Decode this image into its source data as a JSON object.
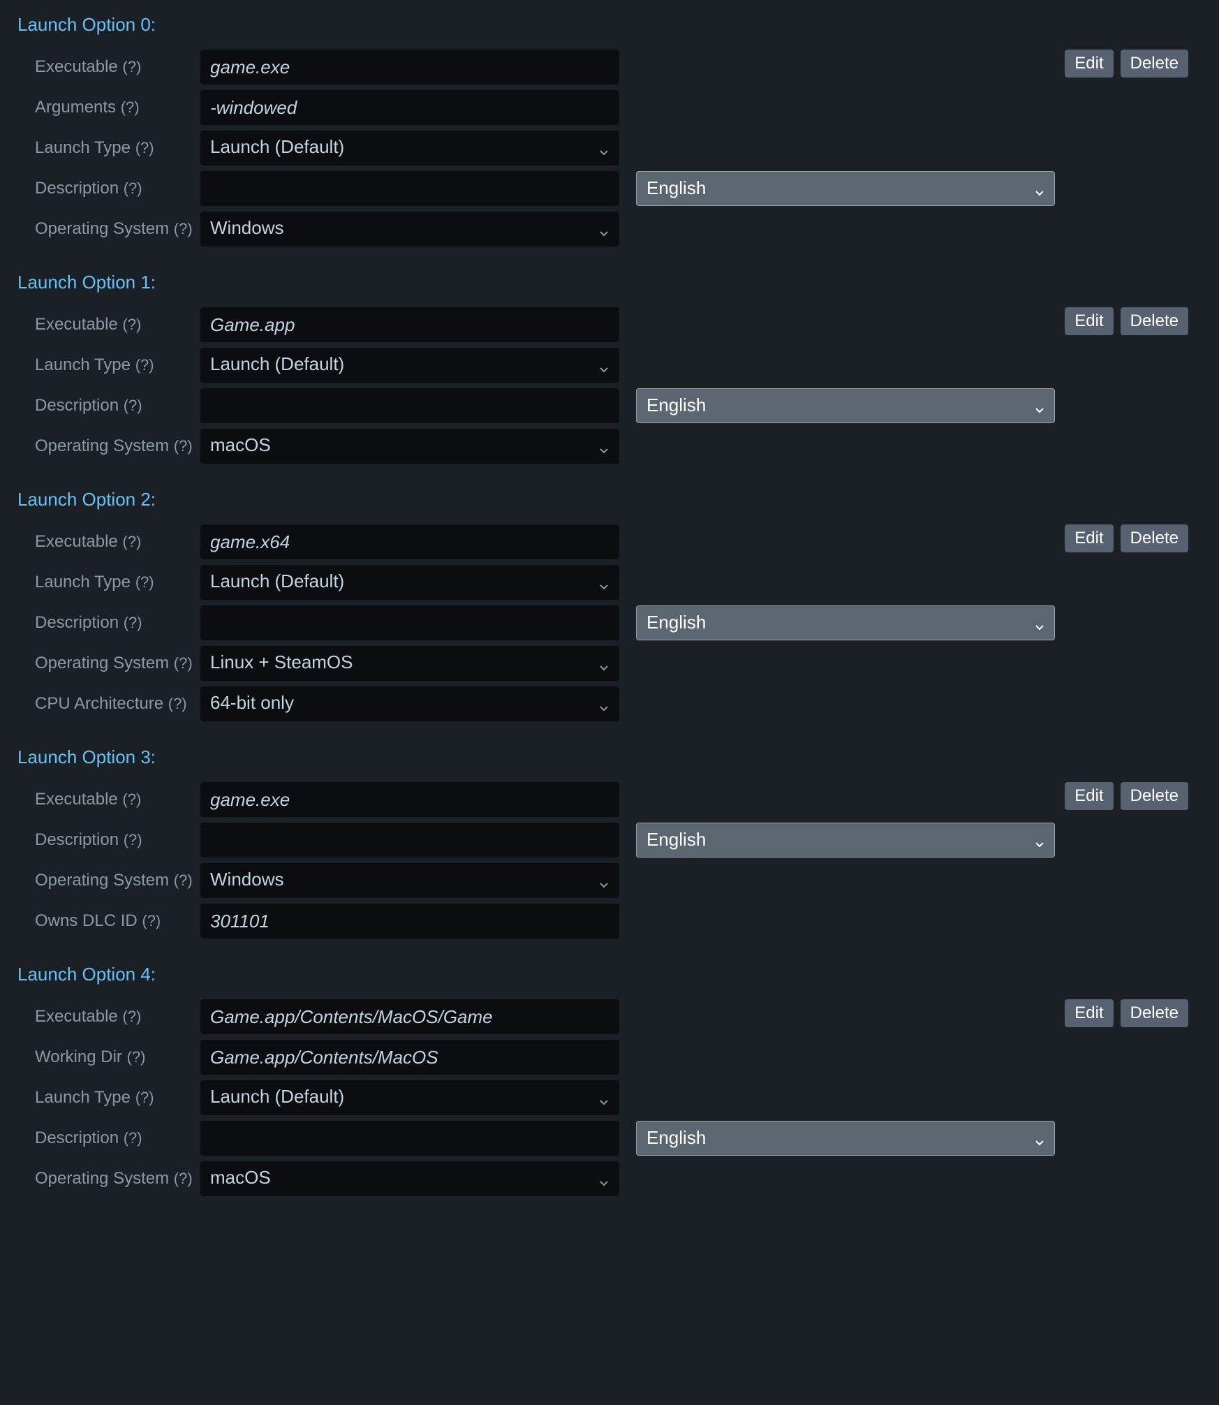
{
  "labels": {
    "executable": "Executable",
    "arguments": "Arguments",
    "launch_type": "Launch Type",
    "description": "Description",
    "operating_system": "Operating System",
    "cpu_arch": "CPU Architecture",
    "owns_dlc_id": "Owns DLC ID",
    "working_dir": "Working Dir",
    "help": "(?)",
    "edit": "Edit",
    "delete": "Delete"
  },
  "defaults": {
    "launch_type": "Launch (Default)",
    "lang": "English"
  },
  "options": [
    {
      "title": "Launch Option 0:",
      "executable": "game.exe",
      "arguments": "-windowed",
      "launch_type": "Launch (Default)",
      "description": "",
      "lang": "English",
      "os": "Windows"
    },
    {
      "title": "Launch Option 1:",
      "executable": "Game.app",
      "launch_type": "Launch (Default)",
      "description": "",
      "lang": "English",
      "os": "macOS"
    },
    {
      "title": "Launch Option 2:",
      "executable": "game.x64",
      "launch_type": "Launch (Default)",
      "description": "",
      "lang": "English",
      "os": "Linux + SteamOS",
      "cpu_arch": "64-bit only"
    },
    {
      "title": "Launch Option 3:",
      "executable": "game.exe",
      "description": "",
      "lang": "English",
      "os": "Windows",
      "owns_dlc_id": "301101"
    },
    {
      "title": "Launch Option 4:",
      "executable": "Game.app/Contents/MacOS/Game",
      "working_dir": "Game.app/Contents/MacOS",
      "launch_type": "Launch (Default)",
      "description": "",
      "lang": "English",
      "os": "macOS"
    }
  ]
}
